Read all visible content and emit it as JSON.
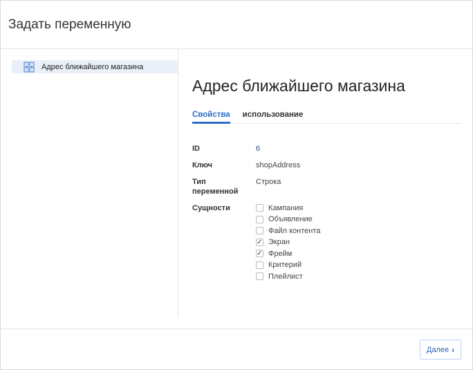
{
  "dialog": {
    "title": "Задать переменную"
  },
  "sidebar": {
    "items": [
      {
        "label": "Адрес ближайшего магазина"
      }
    ]
  },
  "main": {
    "title": "Адрес ближайшего магазина",
    "tabs": [
      {
        "label": "Свойства"
      },
      {
        "label": "использование"
      }
    ],
    "props": {
      "id_label": "ID",
      "id_value": "6",
      "key_label": "Ключ",
      "key_value": "shopAddress",
      "type_label": "Тип переменной",
      "type_value": "Строка",
      "entities_label": "Сущности",
      "entities": [
        {
          "label": "Кампания",
          "checked": false
        },
        {
          "label": "Объявление",
          "checked": false
        },
        {
          "label": "Файл контента",
          "checked": false
        },
        {
          "label": "Экран",
          "checked": true
        },
        {
          "label": "Фрейм",
          "checked": true
        },
        {
          "label": "Критерий",
          "checked": false
        },
        {
          "label": "Плейлист",
          "checked": false
        }
      ]
    }
  },
  "footer": {
    "next_label": "Далее"
  }
}
